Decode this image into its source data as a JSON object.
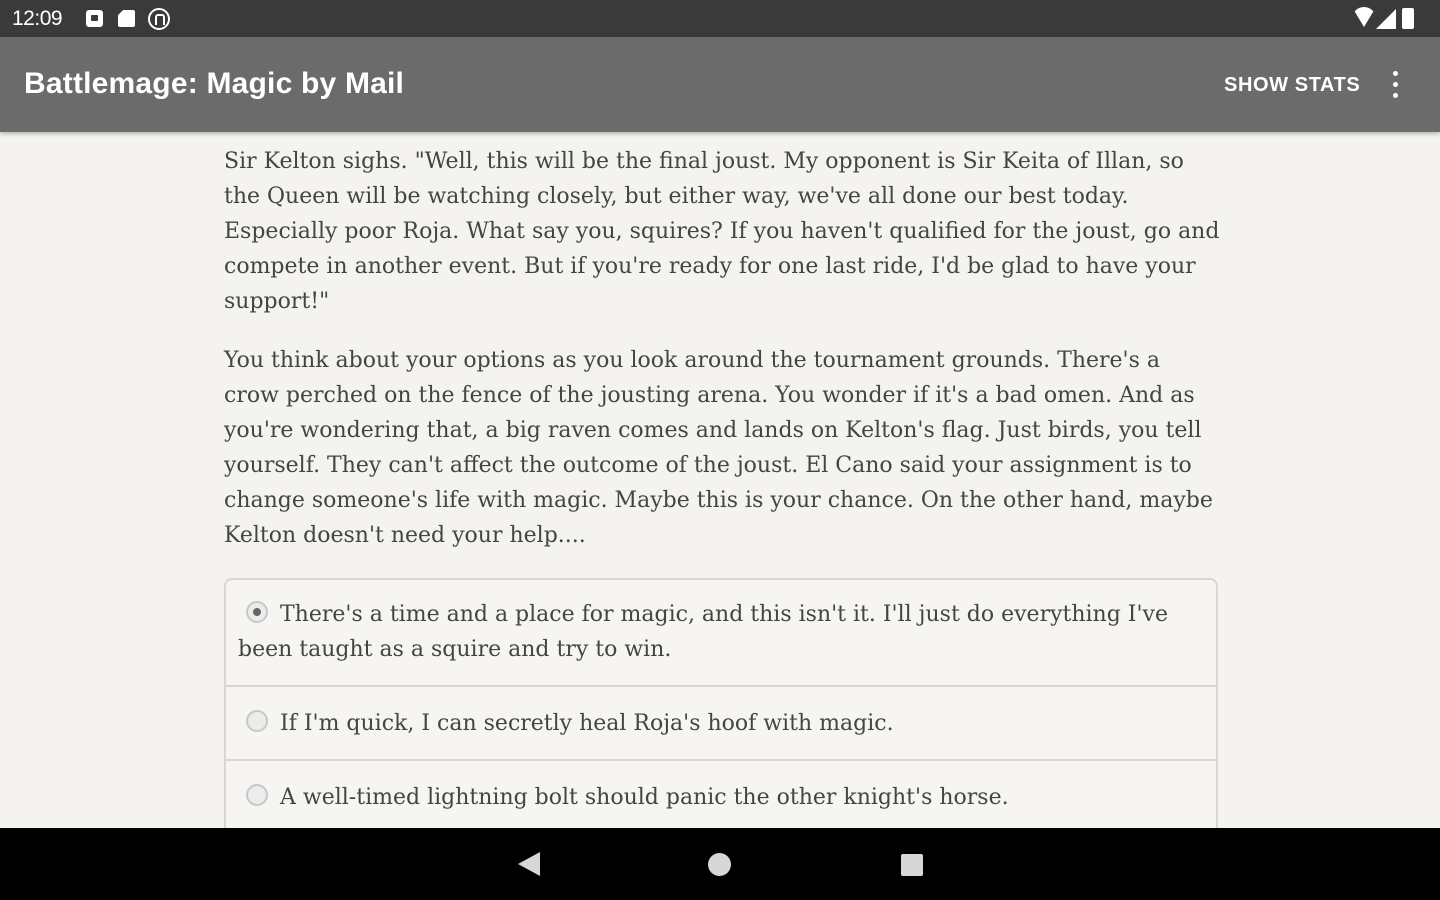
{
  "status_bar": {
    "time": "12:09",
    "icons": [
      "notification-icon",
      "sd-card-icon",
      "sync-icon",
      "wifi-icon",
      "signal-icon",
      "battery-icon"
    ]
  },
  "app_bar": {
    "title": "Battlemage: Magic by Mail",
    "show_stats_label": "SHOW STATS",
    "menu_icon": "overflow-menu-icon",
    "background_color": "#6b6b6b"
  },
  "story": {
    "paragraphs": [
      "Sir Kelton sighs. \"Well, this will be the final joust. My opponent is Sir Keita of Illan, so the Queen will be watching closely, but either way, we've all done our best today. Especially poor Roja. What say you, squires? If you haven't qualified for the joust, go and compete in another event. But if you're ready for one last ride, I'd be glad to have your support!\"",
      "You think about your options as you look around the tournament grounds. There's a crow perched on the fence of the jousting arena. You wonder if it's a bad omen. And as you're wondering that, a big raven comes and lands on Kelton's flag. Just birds, you tell yourself. They can't affect the outcome of the joust. El Cano said your assignment is to change someone's life with magic. Maybe this is your chance. On the other hand, maybe Kelton doesn't need your help...."
    ]
  },
  "choices": [
    {
      "text": "There's a time and a place for magic, and this isn't it. I'll just do everything I've been taught as a squire and try to win.",
      "selected": true
    },
    {
      "text": "If I'm quick, I can secretly heal Roja's hoof with magic.",
      "selected": false
    },
    {
      "text": "A well-timed lightning bolt should panic the other knight's horse.",
      "selected": false
    }
  ],
  "nav_bar": {
    "icons": [
      "back-icon",
      "home-icon",
      "recents-icon"
    ]
  }
}
